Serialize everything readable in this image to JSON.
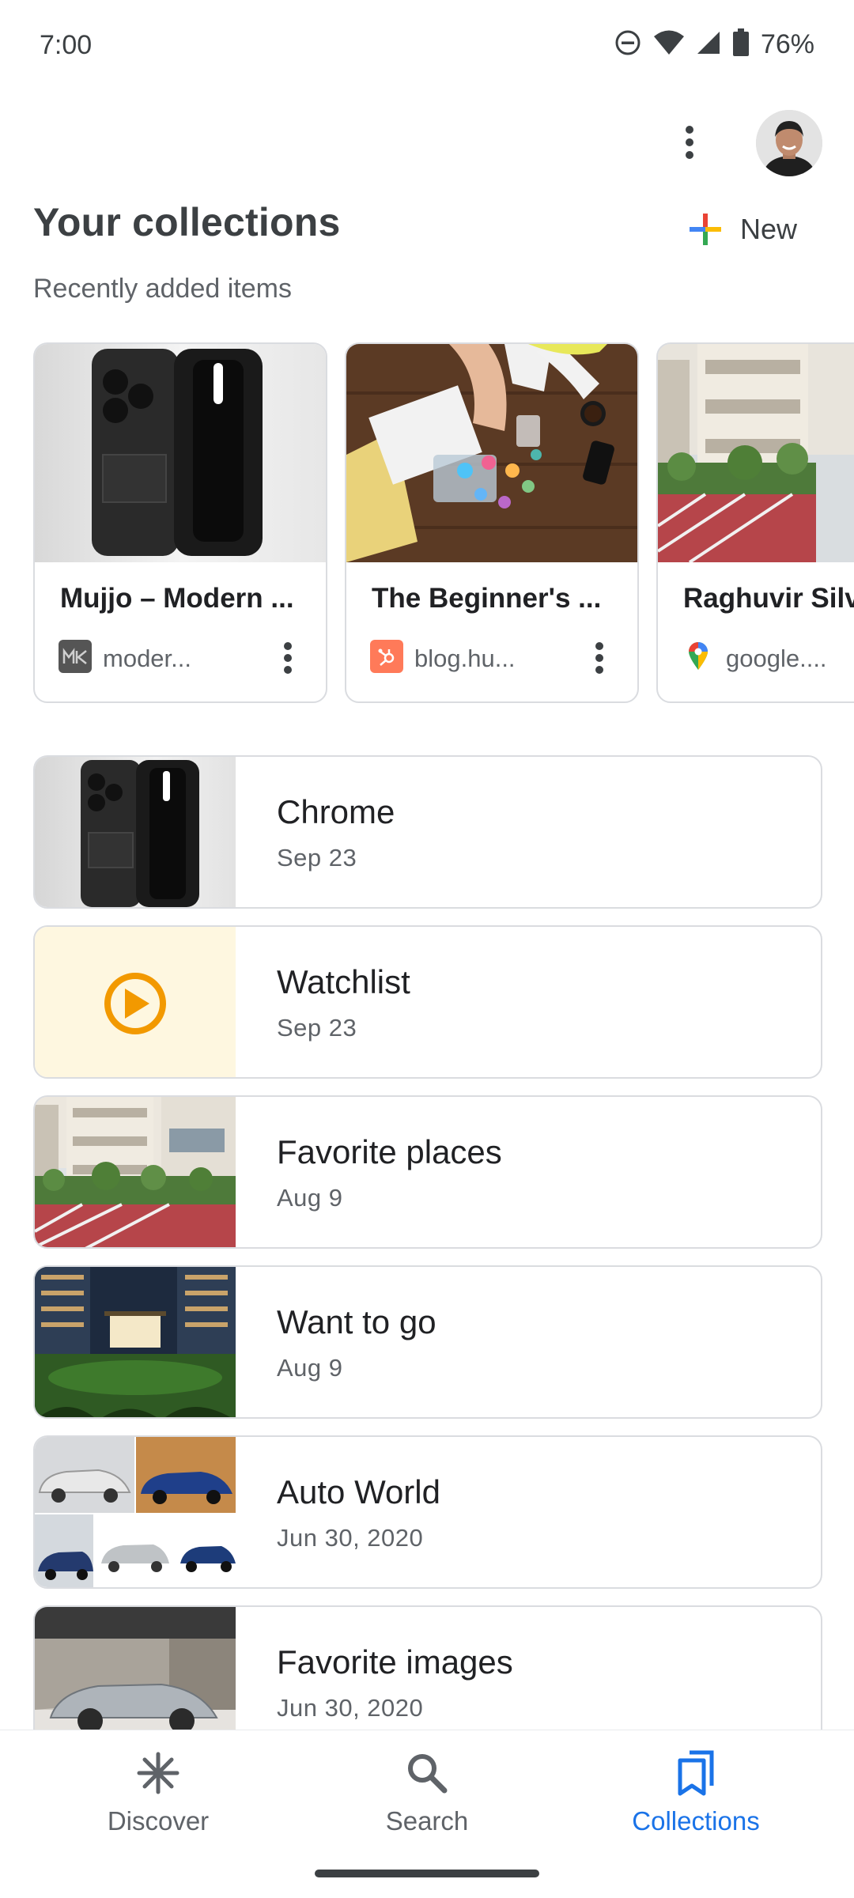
{
  "status_bar": {
    "time": "7:00",
    "battery_percent": "76%",
    "icons": [
      "do-not-disturb-icon",
      "wifi-icon",
      "cell-signal-icon",
      "battery-icon"
    ]
  },
  "header": {
    "title": "Your collections",
    "new_label": "New",
    "subtitle": "Recently added items"
  },
  "recent_items": [
    {
      "title": "Mujjo – Modern ...",
      "source": "moder...",
      "favicon": "mujjo-favicon"
    },
    {
      "title": "The Beginner's ...",
      "source": "blog.hu...",
      "favicon": "hubspot-favicon"
    },
    {
      "title": "Raghuvir Silv",
      "source": "google....",
      "favicon": "maps-pin-favicon"
    }
  ],
  "collections": [
    {
      "name": "Chrome",
      "date": "Sep 23",
      "thumb": "phone-cases"
    },
    {
      "name": "Watchlist",
      "date": "Sep 23",
      "thumb": "play-icon"
    },
    {
      "name": "Favorite places",
      "date": "Aug 9",
      "thumb": "building-track"
    },
    {
      "name": "Want to go",
      "date": "Aug 9",
      "thumb": "night-garden"
    },
    {
      "name": "Auto World",
      "date": "Jun 30, 2020",
      "thumb": "cars-grid"
    },
    {
      "name": "Favorite images",
      "date": "Jun 30, 2020",
      "thumb": "silver-car"
    }
  ],
  "bottom_nav": {
    "items": [
      {
        "label": "Discover",
        "icon": "asterisk-icon",
        "active": false
      },
      {
        "label": "Search",
        "icon": "search-icon",
        "active": false
      },
      {
        "label": "Collections",
        "icon": "bookmarks-icon",
        "active": true
      }
    ]
  },
  "colors": {
    "accent": "#1a73e8",
    "text_primary": "#202124",
    "text_secondary": "#5f6368",
    "border": "#dadce0",
    "watchlist_bg": "#fef7e0",
    "watchlist_play": "#f29900"
  }
}
